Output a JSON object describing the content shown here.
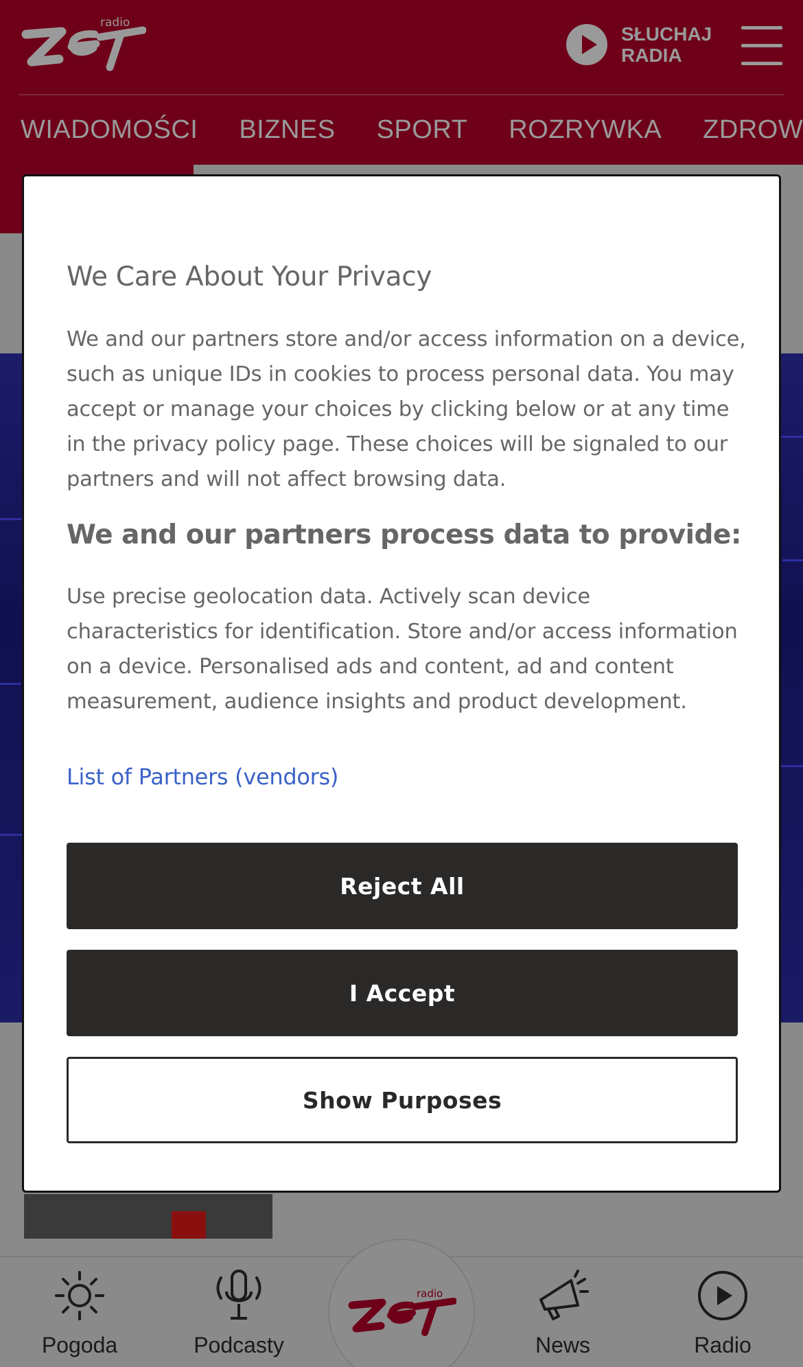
{
  "header": {
    "brand_logo": "radio ZET",
    "listen_button_line1": "SŁUCHAJ",
    "listen_button_line2": "RADIA",
    "nav": [
      "WIADOMOŚCI",
      "BIZNES",
      "SPORT",
      "ROZRYWKA",
      "ZDROW"
    ]
  },
  "consent": {
    "title": "We Care About Your Privacy",
    "body": "We and our partners store and/or access information on a device, such as unique IDs in cookies to process personal data. You may accept or manage your choices by clicking below or at any time in the privacy policy page. These choices will be signaled to our partners and will not affect browsing data.",
    "subtitle": "We and our partners process data to provide:",
    "purposes": "Use precise geolocation data. Actively scan device characteristics for identification. Store and/or access information on a device. Personalised ads and content, ad and content measurement, audience insights and product development.",
    "partners_link": "List of Partners (vendors)",
    "reject_label": "Reject All",
    "accept_label": "I Accept",
    "purposes_button_label": "Show Purposes"
  },
  "bottom_nav": [
    {
      "label": "Pogoda",
      "icon": "sun-icon"
    },
    {
      "label": "Podcasty",
      "icon": "microphone-icon"
    },
    {
      "label": "",
      "icon": "radio-zet-logo"
    },
    {
      "label": "News",
      "icon": "megaphone-icon"
    },
    {
      "label": "Radio",
      "icon": "play-circle-icon"
    }
  ],
  "colors": {
    "header_bg": "#6e0019",
    "dark_button": "#2b2828",
    "link": "#3a62c8"
  }
}
